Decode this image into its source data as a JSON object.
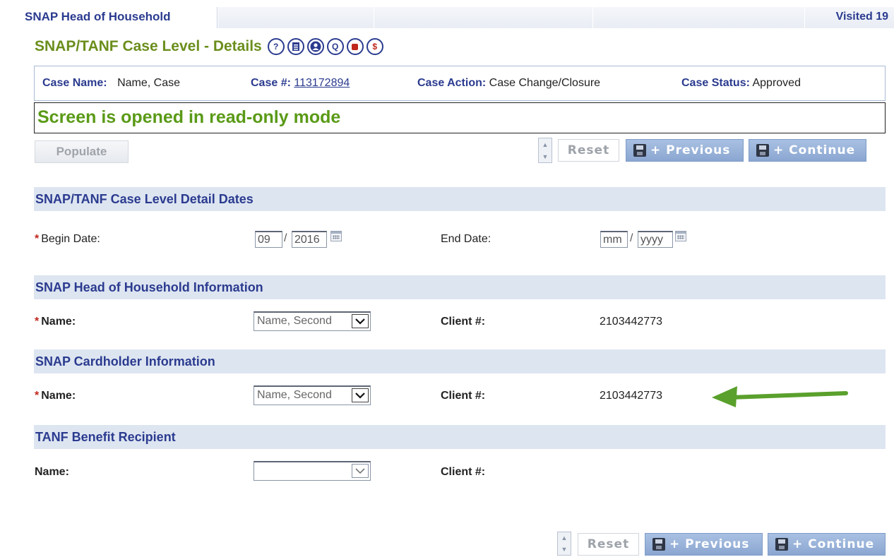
{
  "tabbar": {
    "active_tab": "SNAP Head of Household",
    "visited_text": "Visited 19"
  },
  "page": {
    "title": "SNAP/TANF Case Level - Details",
    "icons": [
      "help-icon",
      "document-icon",
      "person-icon",
      "q-icon",
      "stop-icon",
      "dollar-check-icon"
    ],
    "icon_glyphs": {
      "help": "?",
      "q": "Q",
      "dollar": "$"
    }
  },
  "case": {
    "name_label": "Case Name:",
    "name_value": "Name, Case",
    "number_label": "Case #:",
    "number_value": "113172894",
    "action_label": "Case Action:",
    "action_value": "Case Change/Closure",
    "status_label": "Case Status:",
    "status_value": "Approved"
  },
  "readonly_message": "Screen is opened in read-only mode",
  "toolbar": {
    "populate_label": "Populate",
    "reset_label": "Reset",
    "previous_label": "+ Previous",
    "continue_label": "+ Continue"
  },
  "sections": {
    "dates": {
      "title": "SNAP/TANF Case Level Detail Dates",
      "begin_label": "Begin Date:",
      "begin_month": "09",
      "begin_year": "2016",
      "end_label": "End Date:",
      "end_month_placeholder": "mm",
      "end_year_placeholder": "yyyy",
      "separator": "/",
      "required_mark": "*"
    },
    "head_of_household": {
      "title": "SNAP Head of Household Information",
      "name_label": "Name:",
      "name_value": "Name, Second",
      "client_label": "Client #:",
      "client_value": "2103442773"
    },
    "cardholder": {
      "title": "SNAP Cardholder Information",
      "name_label": "Name:",
      "name_value": "Name, Second",
      "client_label": "Client #:",
      "client_value": "2103442773"
    },
    "tanf": {
      "title": "TANF Benefit Recipient",
      "name_label": "Name:",
      "name_value": "",
      "client_label": "Client #:",
      "client_value": ""
    }
  },
  "colors": {
    "title_green": "#6b8e1c",
    "readonly_green": "#5a9a17",
    "label_blue": "#2b3b8f",
    "section_bg": "#dde5f1",
    "required_red": "#c0271d",
    "annotation_arrow": "#5aa02c"
  }
}
